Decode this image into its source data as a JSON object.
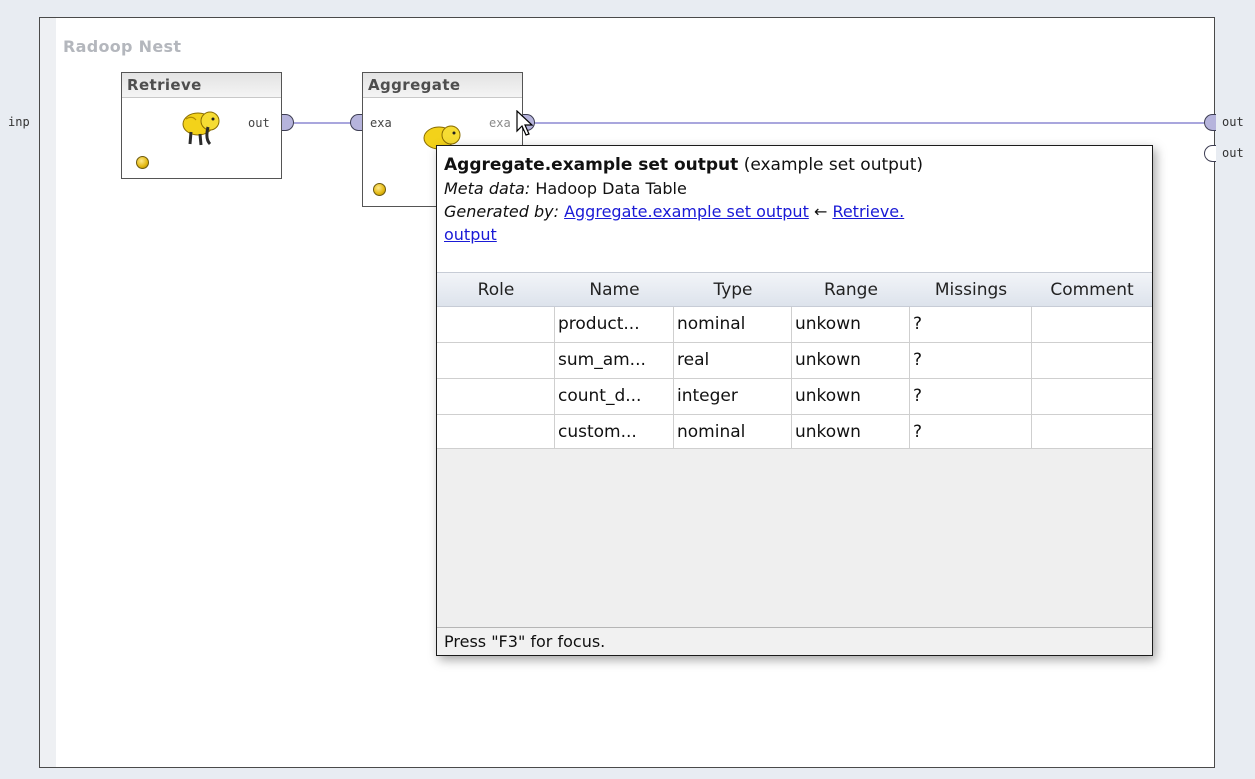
{
  "process": {
    "nest_title": "Radoop Nest",
    "left_input_label": "inp",
    "right_output_labels": [
      "out",
      "out"
    ]
  },
  "operators": [
    {
      "name": "Retrieve",
      "output_port": "out"
    },
    {
      "name": "Aggregate",
      "input_port": "exa",
      "output_port": "exa"
    }
  ],
  "tooltip": {
    "title": "Aggregate.example set output",
    "title_suffix": "(example set output)",
    "meta_label": "Meta data:",
    "meta_value": "Hadoop Data Table",
    "generated_label": "Generated by:",
    "generated_link1": "Aggregate.example set output",
    "arrow": "←",
    "generated_link2_part1": "Retrieve.",
    "generated_link2_part2": "output",
    "columns": [
      "Role",
      "Name",
      "Type",
      "Range",
      "Missings",
      "Comment"
    ],
    "rows": [
      {
        "role": "",
        "name": "product...",
        "type": "nominal",
        "range": "unkown",
        "missings": "?",
        "comment": ""
      },
      {
        "role": "",
        "name": "sum_am...",
        "type": "real",
        "range": "unkown",
        "missings": "?",
        "comment": ""
      },
      {
        "role": "",
        "name": "count_d...",
        "type": "integer",
        "range": "unkown",
        "missings": "?",
        "comment": ""
      },
      {
        "role": "",
        "name": "custom...",
        "type": "nominal",
        "range": "unkown",
        "missings": "?",
        "comment": ""
      }
    ],
    "footer": "Press \"F3\" for focus."
  },
  "icons": [
    "hadoop-elephant-icon",
    "status-indicator-icon",
    "mouse-cursor-icon"
  ],
  "colors": {
    "connection": "#a9a6dd",
    "port_fill": "#b6b4dc",
    "status_yellow": "#e2b70f",
    "link": "#1a1ad6"
  }
}
